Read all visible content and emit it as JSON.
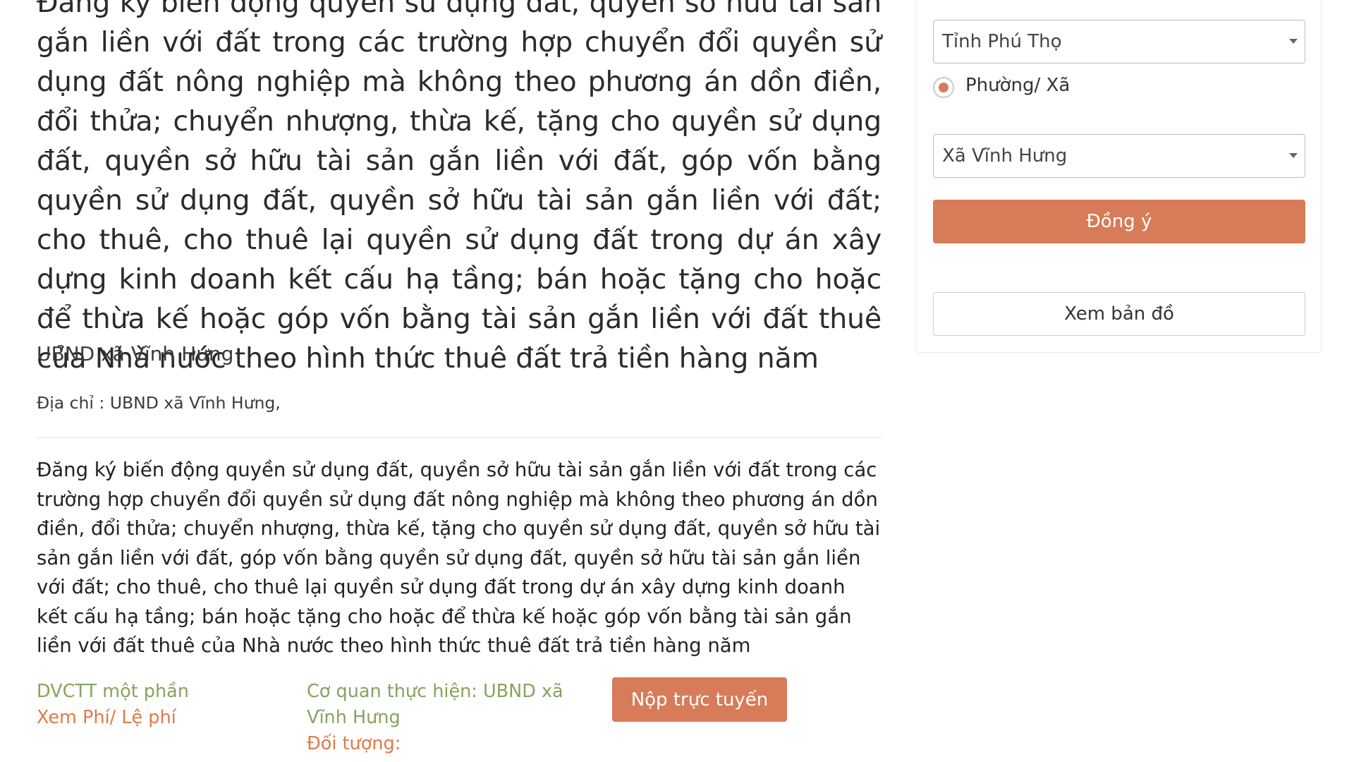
{
  "procedure": {
    "title_text": "Đăng ký biến động quyền sử dụng đất, quyền sở hữu tài sản gắn liền với đất trong các trường hợp chuyển đổi quyền sử dụng đất nông nghiệp mà không theo phương án dồn điền, đổi thửa; chuyển nhượng, thừa kế, tặng cho quyền sử dụng đất, quyền sở hữu tài sản gắn liền với đất, góp vốn bằng quyền sử dụng đất, quyền sở hữu tài sản gắn liền với đất; cho thuê, cho thuê lại quyền sử dụng đất trong dự án xây dựng kinh doanh kết cấu hạ tầng; bán hoặc tặng cho hoặc để thừa kế hoặc góp vốn bằng tài sản gắn liền với đất thuê của Nhà nước theo hình thức thuê đất trả tiền hàng năm",
    "agency_name": "UBND xã Vĩnh Hưng",
    "address_label": "Địa chỉ : ",
    "address_value": "UBND xã Vĩnh Hưng,",
    "description": "Đăng ký biến động quyền sử dụng đất, quyền sở hữu tài sản gắn liền với đất trong các trường hợp chuyển đổi quyền sử dụng đất nông nghiệp mà không theo phương án dồn điền, đổi thửa; chuyển nhượng, thừa kế, tặng cho quyền sử dụng đất, quyền sở hữu tài sản gắn liền với đất, góp vốn bằng quyền sử dụng đất, quyền sở hữu tài sản gắn liền với đất; cho thuê, cho thuê lại quyền sử dụng đất trong dự án xây dựng kinh doanh kết cấu hạ tầng; bán hoặc tặng cho hoặc để thừa kế hoặc góp vốn bằng tài sản gắn liền với đất thuê của Nhà nước theo hình thức thuê đất trả tiền hàng năm",
    "service_level": "DVCTT một phần",
    "fees_link": "Xem Phí/ Lệ phí",
    "agency_label": "Cơ quan thực hiện: UBND xã Vĩnh Hưng",
    "target_label": "Đối tượng:",
    "submit_online_label": "Nộp trực tuyến"
  },
  "sidebar": {
    "province_select": "Tỉnh Phú Thọ",
    "radio_label": "Phường/ Xã",
    "radio_selected": true,
    "ward_select": "Xã Vĩnh Hưng",
    "agree_label": "Đồng ý",
    "map_label": "Xem bản đồ"
  },
  "colors": {
    "accent": "#d77b58",
    "green_text": "#87a35f",
    "orange_text": "#e07a4b"
  }
}
